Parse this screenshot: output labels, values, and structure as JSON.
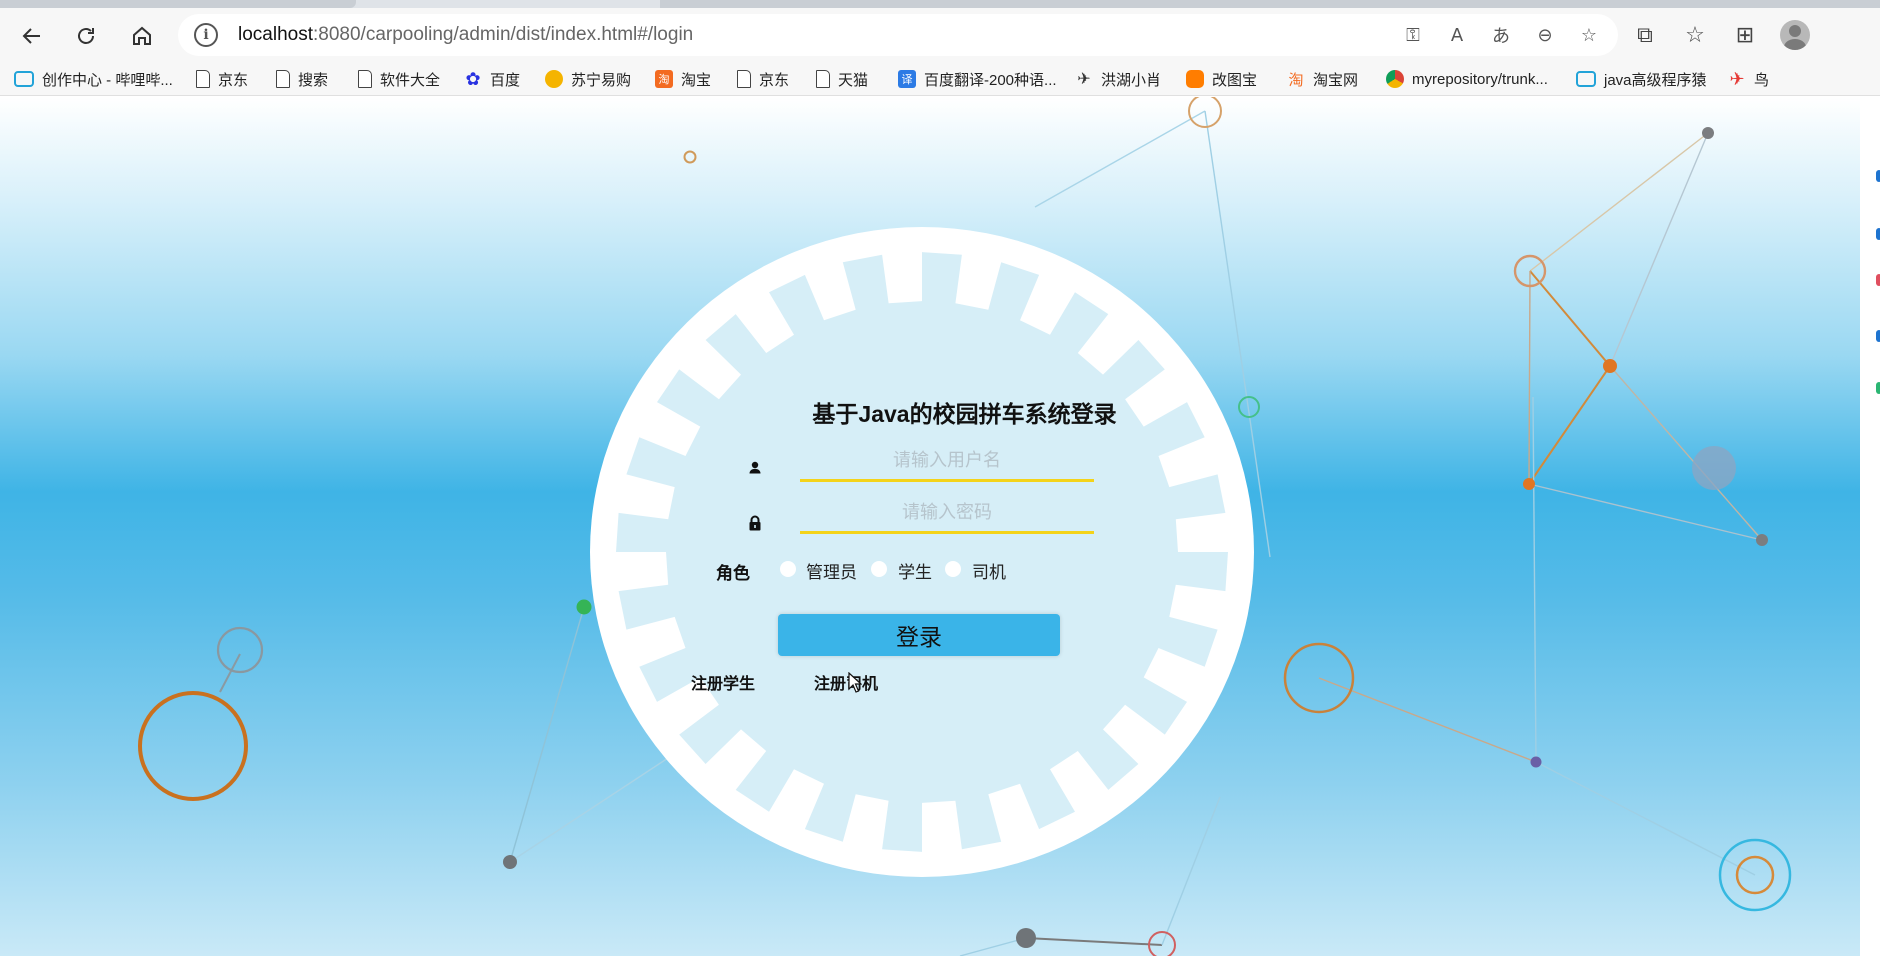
{
  "browser": {
    "url_host": "localhost",
    "url_rest": ":8080/carpooling/admin/dist/index.html#/login"
  },
  "bookmarks": [
    {
      "label": "创作中心 - 哔哩哔...",
      "icon": "bilibili-tv-icon"
    },
    {
      "label": "京东",
      "icon": "page-icon"
    },
    {
      "label": "搜索",
      "icon": "page-icon"
    },
    {
      "label": "软件大全",
      "icon": "page-icon"
    },
    {
      "label": "百度",
      "icon": "baidu-paw-icon"
    },
    {
      "label": "苏宁易购",
      "icon": "suning-lion-icon"
    },
    {
      "label": "淘宝",
      "icon": "taobao-icon"
    },
    {
      "label": "京东",
      "icon": "page-icon"
    },
    {
      "label": "天猫",
      "icon": "page-icon"
    },
    {
      "label": "百度翻译-200种语...",
      "icon": "baidu-translate-icon"
    },
    {
      "label": "洪湖小肖",
      "icon": "bird-icon"
    },
    {
      "label": "改图宝",
      "icon": "gaitubao-icon"
    },
    {
      "label": "淘宝网",
      "icon": "taobao-icon"
    },
    {
      "label": "myrepository/trunk...",
      "icon": "chrome-icon"
    },
    {
      "label": "java高级程序猿",
      "icon": "bilibili-tv-icon"
    },
    {
      "label": "鸟",
      "icon": "bird-red-icon"
    }
  ],
  "login": {
    "title": "基于Java的校园拼车系统登录",
    "username_placeholder": "请输入用户名",
    "password_placeholder": "请输入密码",
    "role_label": "角色",
    "roles": [
      "管理员",
      "学生",
      "司机"
    ],
    "submit_label": "登录",
    "register_student": "注册学生",
    "register_driver": "注册司机"
  },
  "colors": {
    "accent_button": "#3ab4e8",
    "input_underline": "#f4d31a",
    "panel_bg": "#d6eef7"
  }
}
